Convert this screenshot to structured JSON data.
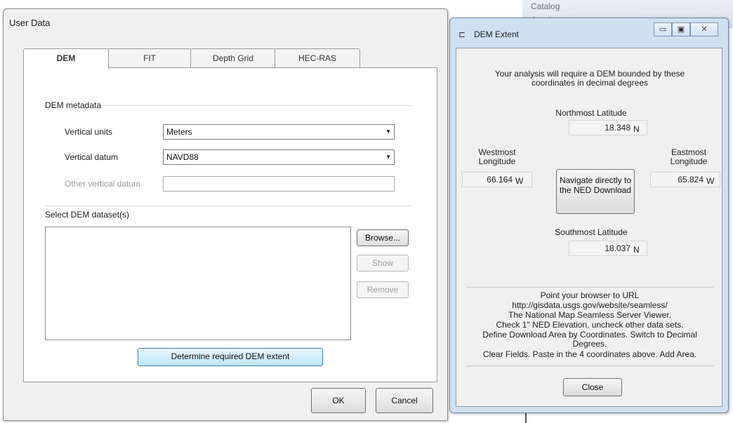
{
  "background": {
    "catalog_title": "Catalog",
    "toolbar_glyphs": "✚ ✎ ⊕ ▣ ↗ ▤"
  },
  "user_data": {
    "title": "User Data",
    "tabs": [
      {
        "label": "DEM",
        "active": true
      },
      {
        "label": "FIT",
        "active": false
      },
      {
        "label": "Depth Grid",
        "active": false
      },
      {
        "label": "HEC-RAS",
        "active": false
      }
    ],
    "metadata": {
      "group_title": "DEM metadata",
      "vertical_units_label": "Vertical units",
      "vertical_units_value": "Meters",
      "vertical_datum_label": "Vertical datum",
      "vertical_datum_value": "NAVD88",
      "other_datum_label": "Other vertical datum",
      "other_datum_value": ""
    },
    "dataset": {
      "group_title": "Select DEM dataset(s)",
      "browse": "Browse...",
      "show": "Show",
      "remove": "Remove",
      "determine": "Determine required DEM extent"
    },
    "ok": "OK",
    "cancel": "Cancel"
  },
  "dem_extent": {
    "title": "DEM Extent",
    "intro": "Your analysis will require a DEM bounded by these coordinates in decimal degrees",
    "north_label": "Northmost Latitude",
    "north_value": "18.348",
    "north_unit": "N",
    "west_label": "Westmost Longitude",
    "west_value": "66.164",
    "west_unit": "W",
    "east_label": "Eastmost Longitude",
    "east_value": "65.824",
    "east_unit": "W",
    "south_label": "Southmost Latitude",
    "south_value": "18.037",
    "south_unit": "N",
    "navigate_button": "Navigate directly to the NED Download",
    "instructions": [
      "Point your browser to URL",
      "http://gisdata.usgs.gov/website/seamless/",
      "The National Map Seamless Server Viewer.",
      "Check 1\" NED Elevation, uncheck other data sets.",
      "Define Download Area by Coordinates. Switch to Decimal Degrees.",
      "Clear Fields. Paste in the 4 coordinates above. Add Area."
    ],
    "close": "Close"
  }
}
